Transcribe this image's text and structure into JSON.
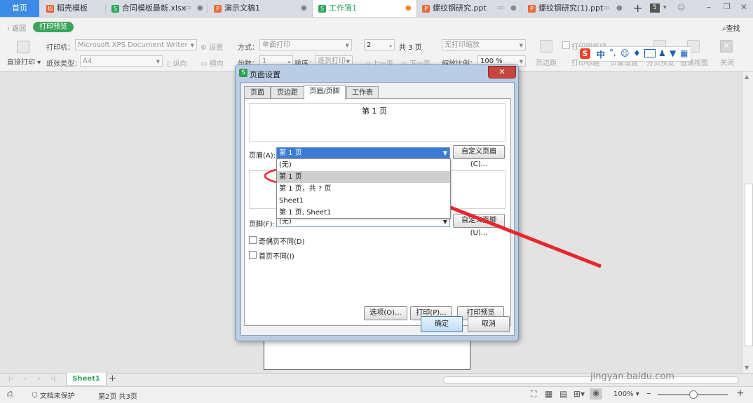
{
  "tabs": [
    {
      "label": "首页"
    },
    {
      "label": "稻壳模板"
    },
    {
      "label": "合同模板最新.xlsx"
    },
    {
      "label": "演示文稿1"
    },
    {
      "label": "工作簿1"
    },
    {
      "label": "螺纹钢研究.ppt"
    },
    {
      "label": "螺纹钢研究(1).ppt"
    }
  ],
  "tab_count_badge": "5",
  "toolbar": {
    "back": "返回",
    "print_preview": "打印预览",
    "search": "查找",
    "printer_label": "打印机：",
    "printer_value": "Microsoft XPS Document Writer",
    "settings": "设置",
    "mode_label": "方式：",
    "mode_value": "单面打印",
    "copies_value": "2",
    "total_pages": "共 3 页",
    "no_scale": "无打印缩放",
    "print_gridlines": "打印网格线",
    "direct_print": "直接打印",
    "paper_label": "纸张类型：",
    "paper_value": "A4",
    "portrait": "纵向",
    "landscape": "横向",
    "copies_label": "份数：",
    "copies_count": "1",
    "order_label": "顺序：",
    "order_value": "逐页打印",
    "prev_page": "上一页",
    "next_page": "下一页",
    "zoom_label": "缩放比例：",
    "zoom_value": "100 %",
    "margins": "页边距",
    "page_setup": "页面设置",
    "print_row_title": "打印标题",
    "split_preview": "分页预览",
    "normal_view": "普通视图",
    "close": "关闭"
  },
  "dialog": {
    "title": "页面设置",
    "tabs": [
      "页面",
      "页边距",
      "页眉/页脚",
      "工作表"
    ],
    "header_preview": "第 1 页",
    "header_label": "页眉(A):",
    "header_value": "第 1 页",
    "custom_header": "自定义页眉(C)...",
    "dropdown_items": [
      "(无)",
      "第 1 页",
      "第 1 页，共 ? 页",
      "Sheet1",
      "第 1 页, Sheet1"
    ],
    "footer_label": "页脚(F):",
    "footer_value": "(无)",
    "custom_footer": "自定义页脚(U)...",
    "odd_even": "奇偶页不同(D)",
    "first_page": "首页不同(I)",
    "options": "选项(O)...",
    "print": "打印(P)...",
    "print_preview": "打印预览(W)...",
    "ok": "确定",
    "cancel": "取消"
  },
  "sheet_tab": "Sheet1",
  "status": {
    "protect": "文档未保护",
    "page_info": "第2页 共3页",
    "zoom": "100%"
  },
  "ime": {
    "lang": "中"
  },
  "watermark": {
    "logo": "Bai经验",
    "url": "jingyan.baidu.com"
  },
  "colors": {
    "accent": "#3c8be6",
    "green": "#3aa55a",
    "annotation": "#e8262b"
  }
}
